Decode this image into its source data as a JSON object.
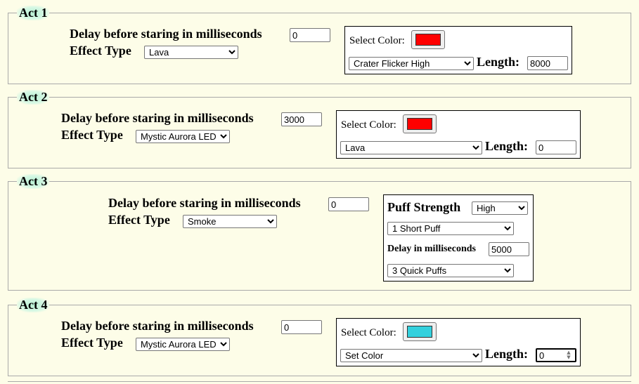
{
  "acts": [
    {
      "legend": "Act 1",
      "delay_label": "Delay before staring in milliseconds",
      "delay_value": "0",
      "effect_label": "Effect Type",
      "effect_value": "Lava",
      "select_color_label": "Select Color:",
      "color": "#ff0000",
      "pattern_value": "Crater Flicker High",
      "length_label": "Length:",
      "length_value": "8000"
    },
    {
      "legend": "Act 2",
      "delay_label": "Delay before staring in milliseconds",
      "delay_value": "3000",
      "effect_label": "Effect Type",
      "effect_value": "Mystic Aurora LED",
      "select_color_label": "Select Color:",
      "color": "#ff0000",
      "pattern_value": "Lava",
      "length_label": "Length:",
      "length_value": "0"
    },
    {
      "legend": "Act 3",
      "delay_label": "Delay before staring in milliseconds",
      "delay_value": "0",
      "effect_label": "Effect Type",
      "effect_value": "Smoke",
      "puff_strength_label": "Puff Strength",
      "puff_strength_value": "High",
      "puff_pattern_value": "1 Short Puff",
      "puff_delay_label": "Delay in milliseconds",
      "puff_delay_value": "5000",
      "puff_pattern2_value": "3 Quick Puffs"
    },
    {
      "legend": "Act 4",
      "delay_label": "Delay before staring in milliseconds",
      "delay_value": "0",
      "effect_label": "Effect Type",
      "effect_value": "Mystic Aurora LED",
      "select_color_label": "Select Color:",
      "color": "#33d0dd",
      "pattern_value": "Set Color",
      "length_label": "Length:",
      "length_value": "0"
    }
  ]
}
